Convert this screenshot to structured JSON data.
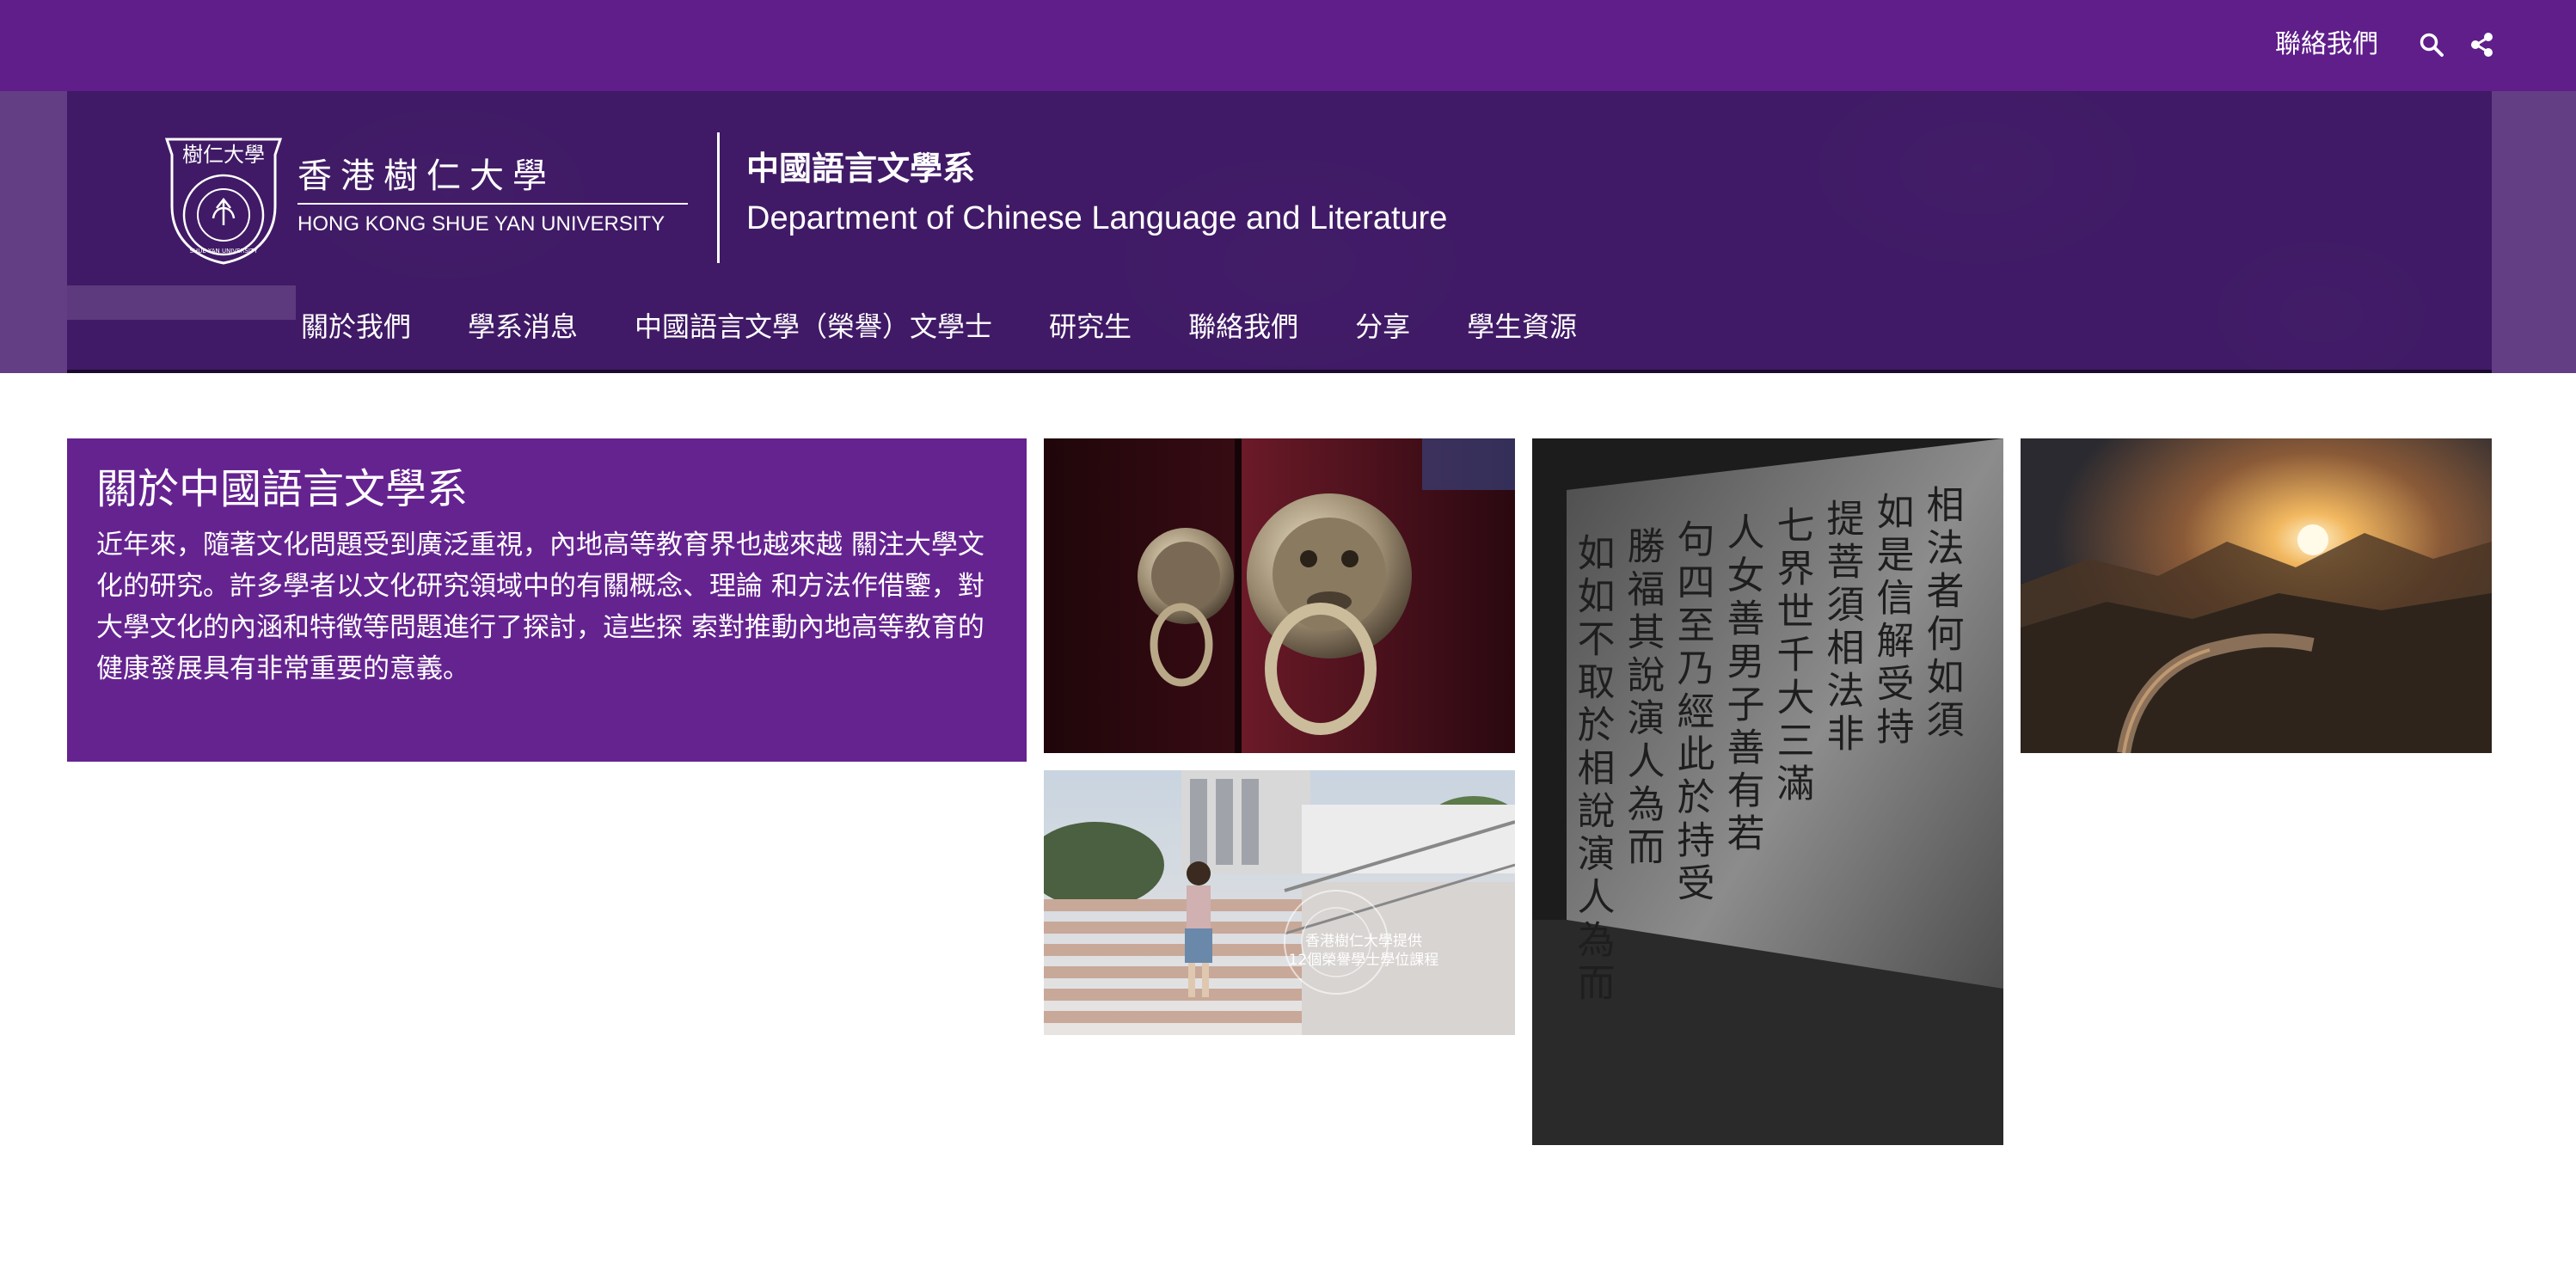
{
  "topbar": {
    "contact_label": "聯絡我們",
    "search_icon": "search-icon",
    "share_icon": "share-icon",
    "background": "#5f1e8a"
  },
  "header": {
    "crest_text": "樹仁大學",
    "crest_ring_text": "SHUE YAN UNIVERSITY",
    "university_cn": "香港樹仁大學",
    "university_en": "HONG KONG SHUE YAN UNIVERSITY",
    "department_cn": "中國語言文學系",
    "department_en": "Department of Chinese Language and Literature"
  },
  "nav": {
    "items": [
      {
        "label": "關於我們"
      },
      {
        "label": "學系消息"
      },
      {
        "label": "中國語言文學（榮譽）文學士"
      },
      {
        "label": "研究生"
      },
      {
        "label": "聯絡我們"
      },
      {
        "label": "分享"
      },
      {
        "label": "學生資源"
      }
    ]
  },
  "about": {
    "title": "關於中國語言文學系",
    "body": "近年來，隨著文化問題受到廣泛重視，內地高等教育界也越來越 關注大學文化的研究。許多學者以文化研究領域中的有關概念、理論 和方法作借鑒，對大學文化的內涵和特徵等問題進行了探討，這些探 索對推動內地高等教育的健康發展具有非常重要的意義。",
    "background": "#652390"
  },
  "gallery": {
    "campus_caption_line1": "香港樹仁大學提供",
    "campus_caption_line2": "12個榮譽學士學位課程",
    "inscription_lines": [
      "如如不取於相說演人為而",
      "勝福其說演人為而",
      "句四至乃經此於持受",
      "人女善男子善有若",
      "七界世千大三滿",
      "提菩須相法非",
      "如是信解受持",
      "相法者何如須"
    ]
  },
  "colors": {
    "brand_purple": "#5f1e8a",
    "hero_purple": "#4a1f70",
    "text_white": "#ffffff"
  }
}
